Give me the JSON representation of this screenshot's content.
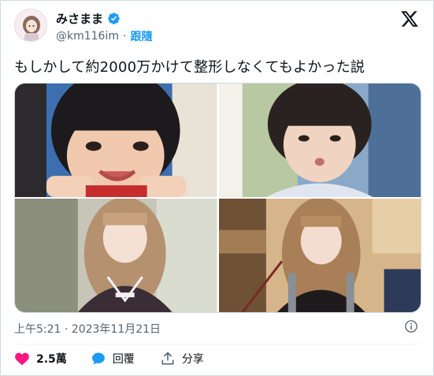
{
  "user": {
    "display_name": "みさまま",
    "handle": "@km116im",
    "separator": "·",
    "follow_label": "跟隨",
    "verified": true
  },
  "tweet": {
    "text": "もしかして約2000万かけて整形しなくてもよかった説",
    "timestamp": "上午5:21 · 2023年11月21日"
  },
  "media": {
    "photos": [
      {
        "id": "photo-child-smiling"
      },
      {
        "id": "photo-child-pouting"
      },
      {
        "id": "photo-adult-garden"
      },
      {
        "id": "photo-adult-cafe"
      }
    ]
  },
  "actions": {
    "like_count": "2.5萬",
    "reply_label": "回覆",
    "share_label": "分享"
  },
  "colors": {
    "like": "#f91880",
    "reply": "#1d9bf0",
    "verified": "#1d9bf0",
    "link": "#1d9bf0",
    "muted": "#536471"
  },
  "icons": [
    "verified-badge-icon",
    "x-logo-icon",
    "info-icon",
    "heart-icon",
    "reply-bubble-icon",
    "share-icon"
  ]
}
